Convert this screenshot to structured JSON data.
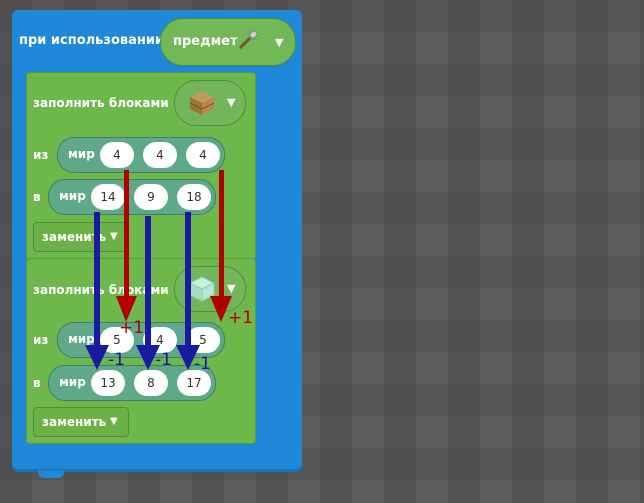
{
  "event": {
    "label": "при использовании",
    "item_label": "предмет",
    "item_icon": "shovel-icon"
  },
  "fill1": {
    "label": "заполнить блоками",
    "block_icon": "oak-planks-icon",
    "from_label": "из",
    "from": {
      "prefix": "мир",
      "x": "4",
      "y": "4",
      "z": "4"
    },
    "to_label": "в",
    "to": {
      "prefix": "мир",
      "x": "14",
      "y": "9",
      "z": "18"
    },
    "mode": "заменить"
  },
  "fill2": {
    "label": "заполнить блоками",
    "block_icon": "glass-block-icon",
    "from_label": "из",
    "from": {
      "prefix": "мир",
      "x": "5",
      "y": "4",
      "z": "5"
    },
    "to_label": "в",
    "to": {
      "prefix": "мир",
      "x": "13",
      "y": "8",
      "z": "17"
    },
    "mode": "заменить"
  },
  "annotations": {
    "plus_x": "+1",
    "plus_z": "+1",
    "minus_x": "-1",
    "minus_y": "-1",
    "minus_z": "-1",
    "red": "#b10000",
    "blue": "#1a1aa0"
  }
}
